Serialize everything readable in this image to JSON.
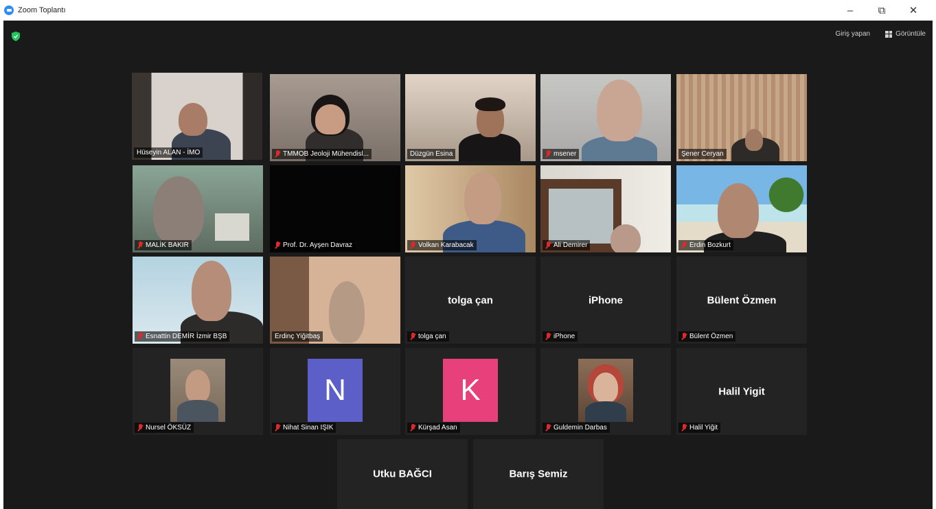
{
  "window": {
    "title": "Zoom Toplantı",
    "minimize": "–",
    "restore": "⧉",
    "close": "✕"
  },
  "toolbar": {
    "signin_label": "Giriş yapan",
    "view_label": "Görüntüle"
  },
  "participants": [
    {
      "name": "Hüseyin ALAN - İMO",
      "muted": false,
      "active": true
    },
    {
      "name": "TMMOB Jeoloji Mühendisl...",
      "muted": true
    },
    {
      "name": "Düzgün Esina",
      "muted": false
    },
    {
      "name": "msener",
      "muted": true
    },
    {
      "name": "Şener Ceryan",
      "muted": false
    },
    {
      "name": "MALİK BAKIR",
      "muted": true
    },
    {
      "name": "Prof. Dr. Ayşen Davraz",
      "muted": true
    },
    {
      "name": "Volkan Karabacak",
      "muted": true
    },
    {
      "name": "Ali Demirer",
      "muted": true
    },
    {
      "name": "Erdin Bozkurt",
      "muted": true
    },
    {
      "name": "Esnattin DEMİR İzmir BŞB",
      "muted": true
    },
    {
      "name": "Erdinç Yiğitbaş",
      "muted": false
    },
    {
      "name": "tolga çan",
      "display": "tolga çan",
      "muted": true
    },
    {
      "name": "iPhone",
      "display": "iPhone",
      "muted": true
    },
    {
      "name": "Bülent Özmen",
      "display": "Bülent Özmen",
      "muted": true
    },
    {
      "name": "Nursel ÖKSÜZ",
      "muted": true
    },
    {
      "name": "Nihat Sinan IŞIK",
      "muted": true,
      "letter": "N"
    },
    {
      "name": "Kürşad Asan",
      "muted": true,
      "letter": "K"
    },
    {
      "name": "Guldemin Darbas",
      "muted": true
    },
    {
      "name": "Halil Yiğit",
      "display": "Halil Yigit",
      "muted": true
    },
    {
      "name": "Utku BAĞCI",
      "display": "Utku BAĞCI"
    },
    {
      "name": "Barış Semiz",
      "display": "Barış Semiz"
    }
  ],
  "colors": {
    "active_border": "#c5d86d",
    "avatar_n": "#5b5fc7",
    "avatar_k": "#e8407a",
    "muted_mic": "#e02828"
  }
}
